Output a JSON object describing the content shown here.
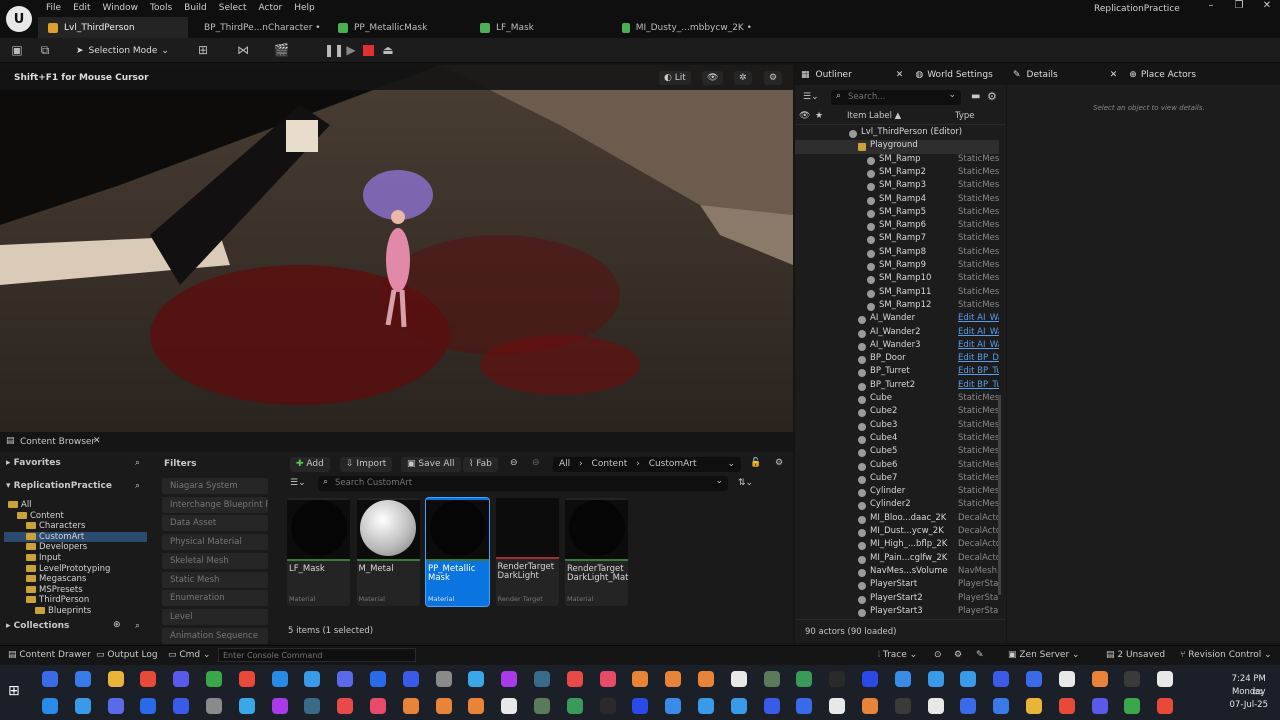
{
  "menu": [
    "File",
    "Edit",
    "Window",
    "Tools",
    "Build",
    "Select",
    "Actor",
    "Help"
  ],
  "app_title": "ReplicationPractice",
  "doc_tabs": [
    {
      "label": "Lvl_ThirdPerson",
      "color": "#e0a030"
    },
    {
      "label": "BP_ThirdPe...nCharacter •",
      "color": "#3a7ad8"
    },
    {
      "label": "PP_MetallicMask",
      "color": "#4caf50"
    },
    {
      "label": "LF_Mask",
      "color": "#4caf50"
    },
    {
      "label": "MI_Dusty_...mbbycw_2K •",
      "color": "#4caf50"
    }
  ],
  "toolbar": {
    "selection_mode": "Selection Mode"
  },
  "viewport": {
    "hint": "Shift+F1 for Mouse Cursor",
    "lit": "Lit"
  },
  "outliner": {
    "tab": "Outliner",
    "tab2": "World Settings",
    "search_placeholder": "Search...",
    "col_label": "Item Label ▲",
    "col_type": "Type",
    "rows": [
      {
        "name": "Lvl_ThirdPerson (Editor)",
        "type": "",
        "indent": 0,
        "sel": false,
        "link": false
      },
      {
        "name": "Playground",
        "type": "",
        "indent": 1,
        "sel": true,
        "link": false
      },
      {
        "name": "SM_Ramp",
        "type": "StaticMes",
        "indent": 2,
        "sel": false,
        "link": false
      },
      {
        "name": "SM_Ramp2",
        "type": "StaticMes",
        "indent": 2,
        "sel": false,
        "link": false
      },
      {
        "name": "SM_Ramp3",
        "type": "StaticMes",
        "indent": 2,
        "sel": false,
        "link": false
      },
      {
        "name": "SM_Ramp4",
        "type": "StaticMes",
        "indent": 2,
        "sel": false,
        "link": false
      },
      {
        "name": "SM_Ramp5",
        "type": "StaticMes",
        "indent": 2,
        "sel": false,
        "link": false
      },
      {
        "name": "SM_Ramp6",
        "type": "StaticMes",
        "indent": 2,
        "sel": false,
        "link": false
      },
      {
        "name": "SM_Ramp7",
        "type": "StaticMes",
        "indent": 2,
        "sel": false,
        "link": false
      },
      {
        "name": "SM_Ramp8",
        "type": "StaticMes",
        "indent": 2,
        "sel": false,
        "link": false
      },
      {
        "name": "SM_Ramp9",
        "type": "StaticMes",
        "indent": 2,
        "sel": false,
        "link": false
      },
      {
        "name": "SM_Ramp10",
        "type": "StaticMes",
        "indent": 2,
        "sel": false,
        "link": false
      },
      {
        "name": "SM_Ramp11",
        "type": "StaticMes",
        "indent": 2,
        "sel": false,
        "link": false
      },
      {
        "name": "SM_Ramp12",
        "type": "StaticMes",
        "indent": 2,
        "sel": false,
        "link": false
      },
      {
        "name": "AI_Wander",
        "type": "Edit AI_Wa",
        "indent": 1,
        "sel": false,
        "link": true
      },
      {
        "name": "AI_Wander2",
        "type": "Edit AI_Wa",
        "indent": 1,
        "sel": false,
        "link": true
      },
      {
        "name": "AI_Wander3",
        "type": "Edit AI_Wa",
        "indent": 1,
        "sel": false,
        "link": true
      },
      {
        "name": "BP_Door",
        "type": "Edit BP_D",
        "indent": 1,
        "sel": false,
        "link": true
      },
      {
        "name": "BP_Turret",
        "type": "Edit BP_Tu",
        "indent": 1,
        "sel": false,
        "link": true
      },
      {
        "name": "BP_Turret2",
        "type": "Edit BP_Tu",
        "indent": 1,
        "sel": false,
        "link": true
      },
      {
        "name": "Cube",
        "type": "StaticMes",
        "indent": 1,
        "sel": false,
        "link": false
      },
      {
        "name": "Cube2",
        "type": "StaticMes",
        "indent": 1,
        "sel": false,
        "link": false
      },
      {
        "name": "Cube3",
        "type": "StaticMes",
        "indent": 1,
        "sel": false,
        "link": false
      },
      {
        "name": "Cube4",
        "type": "StaticMes",
        "indent": 1,
        "sel": false,
        "link": false
      },
      {
        "name": "Cube5",
        "type": "StaticMes",
        "indent": 1,
        "sel": false,
        "link": false
      },
      {
        "name": "Cube6",
        "type": "StaticMes",
        "indent": 1,
        "sel": false,
        "link": false
      },
      {
        "name": "Cube7",
        "type": "StaticMes",
        "indent": 1,
        "sel": false,
        "link": false
      },
      {
        "name": "Cylinder",
        "type": "StaticMes",
        "indent": 1,
        "sel": false,
        "link": false
      },
      {
        "name": "Cylinder2",
        "type": "StaticMes",
        "indent": 1,
        "sel": false,
        "link": false
      },
      {
        "name": "MI_Bloo...daac_2K",
        "type": "DecalActo",
        "indent": 1,
        "sel": false,
        "link": false
      },
      {
        "name": "MI_Dust...ycw_2K",
        "type": "DecalActo",
        "indent": 1,
        "sel": false,
        "link": false
      },
      {
        "name": "MI_High_...bflp_2K",
        "type": "DecalActo",
        "indent": 1,
        "sel": false,
        "link": false
      },
      {
        "name": "MI_Pain...cglfw_2K",
        "type": "DecalActo",
        "indent": 1,
        "sel": false,
        "link": false
      },
      {
        "name": "NavMes...sVolume",
        "type": "NavMesh",
        "indent": 1,
        "sel": false,
        "link": false
      },
      {
        "name": "PlayerStart",
        "type": "PlayerStar",
        "indent": 1,
        "sel": false,
        "link": false
      },
      {
        "name": "PlayerStart2",
        "type": "PlayerStar",
        "indent": 1,
        "sel": false,
        "link": false
      },
      {
        "name": "PlayerStart3",
        "type": "PlayerStar",
        "indent": 1,
        "sel": false,
        "link": false
      }
    ],
    "footer": "90 actors (90 loaded)"
  },
  "details": {
    "tab": "Details",
    "tab2": "Place Actors",
    "empty": "Select an object to view details."
  },
  "content_browser": {
    "tab": "Content Browser",
    "favorites": "Favorites",
    "project": "ReplicationPractice",
    "collections": "Collections",
    "filters_label": "Filters",
    "add": "Add",
    "import": "Import",
    "save_all": "Save All",
    "fab": "Fab",
    "path": [
      "All",
      "Content",
      "CustomArt"
    ],
    "search_placeholder": "Search CustomArt",
    "tree": [
      {
        "label": "All",
        "indent": 0,
        "sel": false
      },
      {
        "label": "Content",
        "indent": 1,
        "sel": false
      },
      {
        "label": "Characters",
        "indent": 2,
        "sel": false
      },
      {
        "label": "CustomArt",
        "indent": 2,
        "sel": true
      },
      {
        "label": "Developers",
        "indent": 2,
        "sel": false
      },
      {
        "label": "Input",
        "indent": 2,
        "sel": false
      },
      {
        "label": "LevelPrototyping",
        "indent": 2,
        "sel": false
      },
      {
        "label": "Megascans",
        "indent": 2,
        "sel": false
      },
      {
        "label": "MSPresets",
        "indent": 2,
        "sel": false
      },
      {
        "label": "ThirdPerson",
        "indent": 2,
        "sel": false
      },
      {
        "label": "Blueprints",
        "indent": 3,
        "sel": false
      }
    ],
    "filters": [
      "Niagara System",
      "Interchange Blueprint Pip",
      "Data Asset",
      "Physical Material",
      "Skeletal Mesh",
      "Static Mesh",
      "Enumeration",
      "Level",
      "Animation Sequence"
    ],
    "assets": [
      {
        "name": "LF_Mask",
        "type": "Material",
        "thumb": "black",
        "sel": false
      },
      {
        "name": "M_Metal",
        "type": "Material",
        "thumb": "sphere",
        "sel": false
      },
      {
        "name": "PP_Metallic Mask",
        "type": "Material",
        "thumb": "black",
        "sel": true
      },
      {
        "name": "RenderTarget DarkLight",
        "type": "Render Target",
        "thumb": "square",
        "sel": false
      },
      {
        "name": "RenderTarget DarkLight_Mat",
        "type": "Material",
        "thumb": "black",
        "sel": false
      }
    ],
    "item_count": "5 items (1 selected)"
  },
  "statusbar": {
    "drawer": "Content Drawer",
    "output": "Output Log",
    "cmd": "Cmd",
    "console_placeholder": "Enter Console Command",
    "trace": "Trace",
    "zen": "Zen Server",
    "unsaved": "2 Unsaved",
    "revision": "Revision Control"
  },
  "clock": {
    "time": "7:24 PM",
    "day": "Monday",
    "date": "07-Jul-25"
  }
}
